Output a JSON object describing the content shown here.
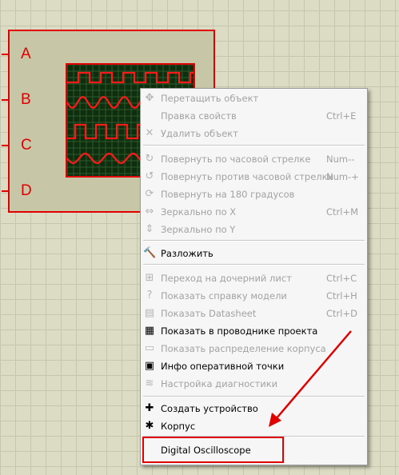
{
  "component": {
    "pins": [
      "A",
      "B",
      "C",
      "D"
    ]
  },
  "menu": {
    "items": [
      {
        "icon": "move-icon",
        "glyph": "✥",
        "label": "Перетащить объект",
        "shortcut": "",
        "enabled": false
      },
      {
        "icon": "properties-icon",
        "glyph": "",
        "label": "Правка свойств",
        "shortcut": "Ctrl+E",
        "enabled": false
      },
      {
        "icon": "delete-icon",
        "glyph": "✕",
        "label": "Удалить объект",
        "shortcut": "",
        "enabled": false
      },
      {
        "icon": "rotate-cw-icon",
        "glyph": "↻",
        "label": "Повернуть по часовой стрелке",
        "shortcut": "Num--",
        "enabled": false
      },
      {
        "icon": "rotate-ccw-icon",
        "glyph": "↺",
        "label": "Повернуть против часовой стрелки",
        "shortcut": "Num-+",
        "enabled": false
      },
      {
        "icon": "rotate-180-icon",
        "glyph": "⟳",
        "label": "Повернуть на 180 градусов",
        "shortcut": "",
        "enabled": false
      },
      {
        "icon": "mirror-x-icon",
        "glyph": "⇔",
        "label": "Зеркально по X",
        "shortcut": "Ctrl+M",
        "enabled": false
      },
      {
        "icon": "mirror-y-icon",
        "glyph": "⇕",
        "label": "Зеркально по Y",
        "shortcut": "",
        "enabled": false
      },
      {
        "icon": "hammer-icon",
        "glyph": "🔨",
        "label": "Разложить",
        "shortcut": "",
        "enabled": true
      },
      {
        "icon": "child-sheet-icon",
        "glyph": "⊞",
        "label": "Переход на дочерний лист",
        "shortcut": "Ctrl+C",
        "enabled": false
      },
      {
        "icon": "help-icon",
        "glyph": "?",
        "label": "Показать справку модели",
        "shortcut": "Ctrl+H",
        "enabled": false
      },
      {
        "icon": "datasheet-icon",
        "glyph": "▤",
        "label": "Показать Datasheet",
        "shortcut": "Ctrl+D",
        "enabled": false
      },
      {
        "icon": "project-explorer-icon",
        "glyph": "▦",
        "label": "Показать в проводнике проекта",
        "shortcut": "",
        "enabled": true
      },
      {
        "icon": "package-icon",
        "glyph": "▭",
        "label": "Показать распределение корпуса",
        "shortcut": "",
        "enabled": false
      },
      {
        "icon": "probe-info-icon",
        "glyph": "▣",
        "label": "Инфо оперативной точки",
        "shortcut": "",
        "enabled": true
      },
      {
        "icon": "diagnostics-icon",
        "glyph": "≋",
        "label": "Настройка диагностики",
        "shortcut": "",
        "enabled": false
      },
      {
        "icon": "make-device-icon",
        "glyph": "✚",
        "label": "Создать устройство",
        "shortcut": "",
        "enabled": true
      },
      {
        "icon": "package-tool-icon",
        "glyph": "✱",
        "label": "Корпус",
        "shortcut": "",
        "enabled": true
      },
      {
        "icon": "",
        "glyph": "",
        "label": "Digital Oscilloscope",
        "shortcut": "",
        "enabled": true
      }
    ]
  },
  "colors": {
    "annotation_red": "#e00000",
    "screen_bg": "#0e2e0e",
    "trace_red": "#ff1a1a"
  }
}
